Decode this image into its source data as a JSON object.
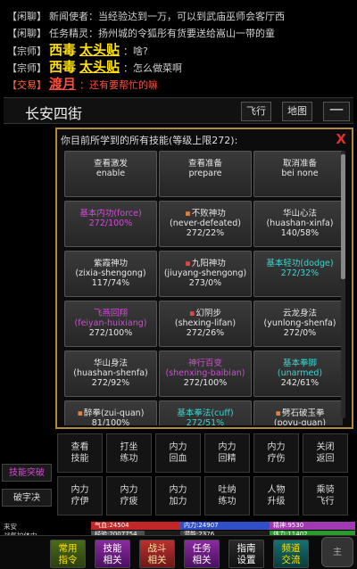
{
  "chat": {
    "lines": [
      {
        "channel": "【闲聊】",
        "speaker": "新闻使者：",
        "text": "当经验达到一万，可以到武庙巫师会客厅西"
      },
      {
        "channel": "【闲聊】",
        "speaker": "任务精灵：",
        "text": "扬州城的令狐彤有货要送给嵩山一带的童"
      },
      {
        "channel": "【宗师】",
        "name": "西毒",
        "title": "太头贴",
        "text": "：啥?"
      },
      {
        "channel": "【宗师】",
        "name": "西毒",
        "title": "太头贴",
        "text": "：怎么做菜啊"
      },
      {
        "channel": "【交易】",
        "name": "渡月",
        "text": "：还有要帮忙的嘛"
      }
    ]
  },
  "location": {
    "title": "长安四街",
    "fly_label": "飞行",
    "map_label": "地图",
    "menu_label": "一"
  },
  "skills_panel": {
    "title": "你目前所学到的所有技能(等级上限272):",
    "close_label": "X",
    "cards": [
      {
        "line1": "查看激发",
        "line2": "enable",
        "line3": "",
        "color": "#e6e6e6"
      },
      {
        "line1": "查看准备",
        "line2": "prepare",
        "line3": "",
        "color": "#e6e6e6"
      },
      {
        "line1": "取消准备",
        "line2": "bei none",
        "line3": "",
        "color": "#e6e6e6"
      },
      {
        "line1": "基本内功(force)",
        "line2": "272/100%",
        "line3": "",
        "color": "#d44ad8"
      },
      {
        "line1": "不败神功",
        "line2": "(never-defeated)",
        "line3": "272/22%",
        "color": "#e6e6e6",
        "mark": "orange"
      },
      {
        "line1": "华山心法",
        "line2": "(huashan-xinfa)",
        "line3": "140/58%",
        "color": "#e6e6e6"
      },
      {
        "line1": "紫霞神功",
        "line2": "(zixia-shengong)",
        "line3": "117/74%",
        "color": "#e6e6e6"
      },
      {
        "line1": "九阳神功",
        "line2": "(jiuyang-shengong)",
        "line3": "273/0%",
        "color": "#e6e6e6",
        "mark": "red"
      },
      {
        "line1": "基本轻功(dodge)",
        "line2": "272/32%",
        "line3": "",
        "color": "#3ad6d0"
      },
      {
        "line1": "飞燕回翔",
        "line2": "(feiyan-huixiang)",
        "line3": "272/100%",
        "color": "#d44ad8"
      },
      {
        "line1": "幻阴步",
        "line2": "(shexing-lifan)",
        "line3": "272/26%",
        "color": "#e6e6e6",
        "mark": "red"
      },
      {
        "line1": "云龙身法",
        "line2": "(yunlong-shenfa)",
        "line3": "272/0%",
        "color": "#e6e6e6"
      },
      {
        "line1": "华山身法",
        "line2": "(huashan-shenfa)",
        "line3": "272/92%",
        "color": "#e6e6e6"
      },
      {
        "line1": "神行百变",
        "line2": "(shenxing-baibian)",
        "line3": "272/100%",
        "color": "#d44ad8"
      },
      {
        "line1": "基本拳脚",
        "line2": "(unarmed)",
        "line3": "242/61%",
        "color": "#3ad6d0"
      },
      {
        "line1": "醉拳(zui-quan)",
        "line2": "81/100%",
        "line3": "",
        "color": "#e6e6e6",
        "mark": "orange"
      },
      {
        "line1": "基本拳法(cuff)",
        "line2": "272/51%",
        "line3": "",
        "color": "#3ad6d0"
      },
      {
        "line1": "劈石破玉拳",
        "line2": "(poyu-quan)",
        "line3": "",
        "color": "#e6e6e6",
        "mark": "orange"
      }
    ]
  },
  "side_buttons": {
    "skill_cultivate": "技能突破",
    "break_word": "破字决"
  },
  "actions": [
    [
      "查看技能",
      "打坐练功",
      "内力回血",
      "内力回精",
      "内力疗伤",
      "关闭返回"
    ],
    [
      "内力疗伊",
      "内力疗疲",
      "内力加力",
      "吐纳练功",
      "人物升级",
      "乘骑飞行"
    ]
  ],
  "status": {
    "row1_label": "来安",
    "row2_label": "战气护体中",
    "bars": [
      {
        "label": "气血:24504",
        "fill": 1.0,
        "color": "#c02828"
      },
      {
        "label": "内力:24907",
        "fill": 1.0,
        "color": "#3050c8"
      },
      {
        "label": "精神:9530",
        "fill": 1.0,
        "color": "#a03ab0"
      },
      {
        "label": "经验:2007754",
        "fill": 0.6,
        "color": "#505050"
      },
      {
        "label": "潜能:2376",
        "fill": 0.3,
        "color": "#404040"
      },
      {
        "label": "体力:11402",
        "fill": 1.0,
        "color": "#2a9a2a"
      }
    ]
  },
  "tabs": [
    {
      "label": "常用指令",
      "style": "g"
    },
    {
      "label": "技能相关",
      "style": "p"
    },
    {
      "label": "战斗相关",
      "style": "r"
    },
    {
      "label": "任务相关",
      "style": "p"
    },
    {
      "label": "指南设置",
      "style": "k"
    },
    {
      "label": "频道交流",
      "style": "t"
    }
  ],
  "main_button": "主"
}
